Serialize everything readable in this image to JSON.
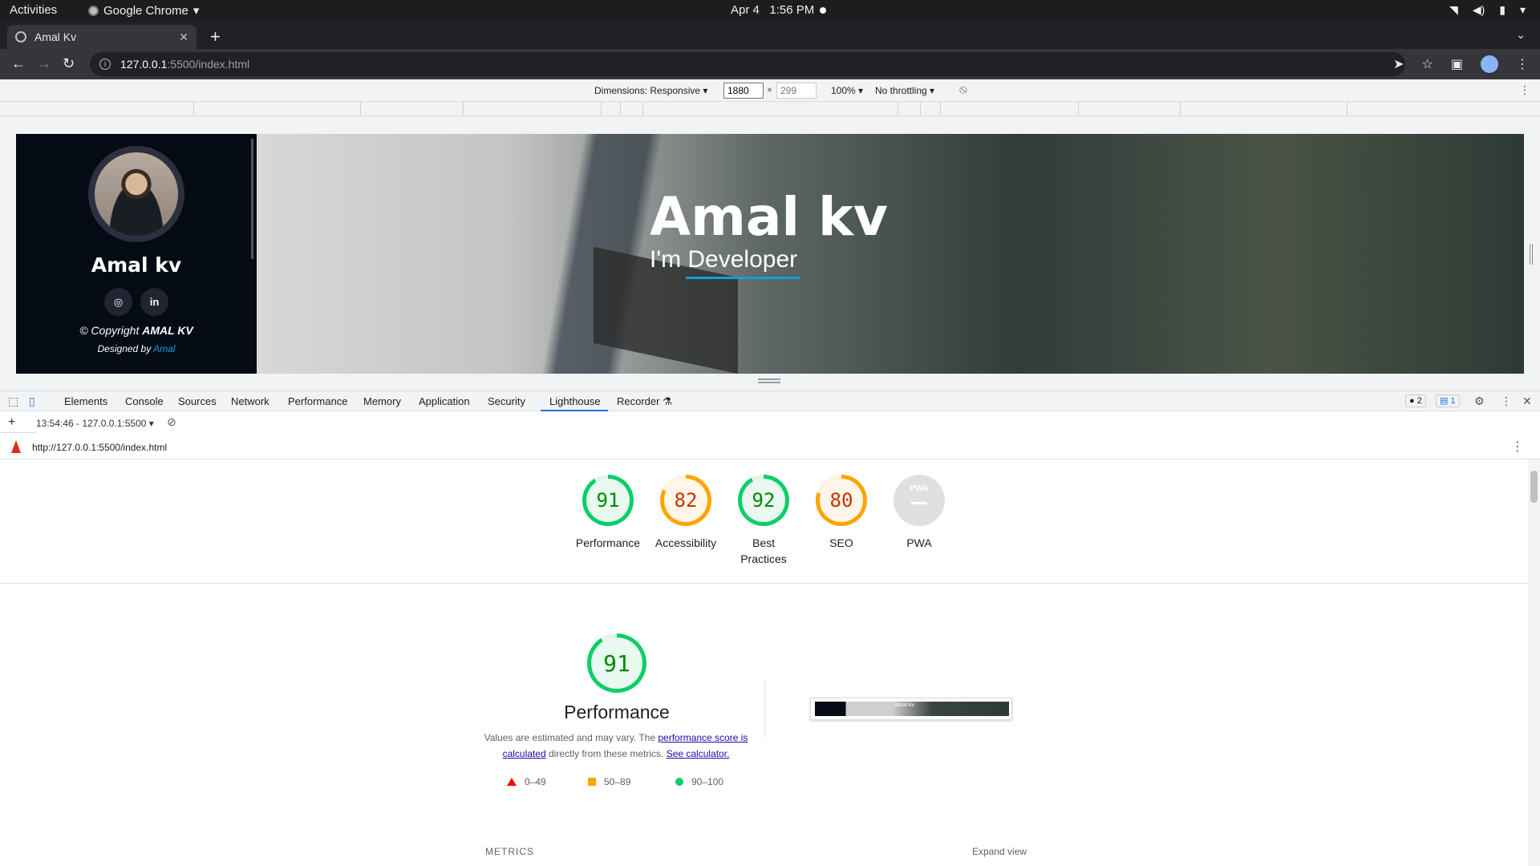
{
  "os_bar": {
    "activities": "Activities",
    "app_name": "Google Chrome",
    "date": "Apr 4",
    "time": "1:56 PM"
  },
  "browser": {
    "tab_title": "Amal Kv",
    "url_host": "127.0.0.1",
    "url_path": ":5500/index.html"
  },
  "device_toolbar": {
    "dimensions_label": "Dimensions: Responsive",
    "width": "1880",
    "height_placeholder": "299",
    "times": "×",
    "zoom": "100%",
    "throttling": "No throttling"
  },
  "site": {
    "sidebar_name": "Amal kv",
    "copyright_prefix": "© Copyright ",
    "copyright_owner": "AMAL KV",
    "designed_prefix": "Designed by ",
    "designed_by": "Amal",
    "hero_title": "Amal kv",
    "hero_subtitle": "I'm Developer"
  },
  "devtools": {
    "tabs": [
      "Elements",
      "Console",
      "Sources",
      "Network",
      "Performance",
      "Memory",
      "Application",
      "Security",
      "Lighthouse",
      "Recorder"
    ],
    "active_tab": "Lighthouse",
    "errors_count": "2",
    "messages_count": "1",
    "report_label": "13:54:46 - 127.0.0.1:5500",
    "report_url": "http://127.0.0.1:5500/index.html"
  },
  "lighthouse": {
    "scores": [
      {
        "label": "Performance",
        "score": 91,
        "status": "pass"
      },
      {
        "label": "Accessibility",
        "score": 82,
        "status": "average"
      },
      {
        "label": "Best Practices",
        "score": 92,
        "status": "pass"
      },
      {
        "label": "SEO",
        "score": 80,
        "status": "average"
      },
      {
        "label": "PWA",
        "score": null,
        "status": "na"
      }
    ],
    "pwa_badge": "PWA",
    "performance": {
      "score": "91",
      "title": "Performance",
      "desc_start": "Values are estimated and may vary. The ",
      "link1": "performance score is calculated",
      "desc_mid": " directly from these metrics. ",
      "link2": "See calculator."
    },
    "legend": {
      "fail": "0–49",
      "average": "50–89",
      "pass": "90–100"
    },
    "thumbnail_text": "Amal kv",
    "metrics_label": "METRICS",
    "expand_view": "Expand view"
  },
  "colors": {
    "pass": "#0cce6b",
    "average": "#ffa400",
    "fail": "#eb0f00",
    "accent": "#149ddd",
    "active_tab": "#1a73e8"
  }
}
